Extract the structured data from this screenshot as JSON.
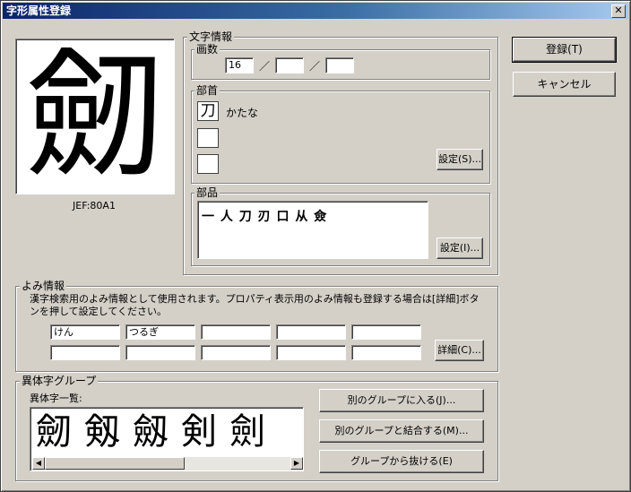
{
  "window": {
    "title": "字形属性登録",
    "close_glyph": "✕"
  },
  "glyph": {
    "character": "劒",
    "code": "JEF:80A1"
  },
  "char_info": {
    "label": "文字情報",
    "strokes": {
      "label": "画数",
      "values": [
        "16",
        "",
        ""
      ],
      "separator": "／"
    },
    "radical": {
      "label": "部首",
      "items": [
        {
          "char": "刀",
          "reading": "かたな"
        },
        {
          "char": "",
          "reading": ""
        },
        {
          "char": "",
          "reading": ""
        }
      ],
      "set_button": "設定(S)..."
    },
    "parts": {
      "label": "部品",
      "value": "一 人 刀 刃 口 从 僉",
      "set_button": "設定(I)..."
    }
  },
  "reading_info": {
    "label": "よみ情報",
    "description": "漢字検索用のよみ情報として使用されます。プロパティ表示用のよみ情報も登録する場合は[詳細]ボタンを押して設定してください。",
    "fields_row1": [
      "けん",
      "つるぎ",
      "",
      "",
      ""
    ],
    "fields_row2": [
      "",
      "",
      "",
      "",
      ""
    ],
    "detail_button": "詳細(C)..."
  },
  "variant_group": {
    "label": "異体字グループ",
    "list_label": "異体字一覧:",
    "variants": [
      "劒",
      "剱",
      "劔",
      "剣",
      "劍"
    ],
    "buttons": {
      "join": "別のグループに入る(J)...",
      "merge": "別のグループと結合する(M)...",
      "leave": "グループから抜ける(E)"
    }
  },
  "dialog_buttons": {
    "ok": "登録(T)",
    "cancel": "キャンセル"
  },
  "scroll": {
    "left": "◀",
    "right": "▶"
  }
}
